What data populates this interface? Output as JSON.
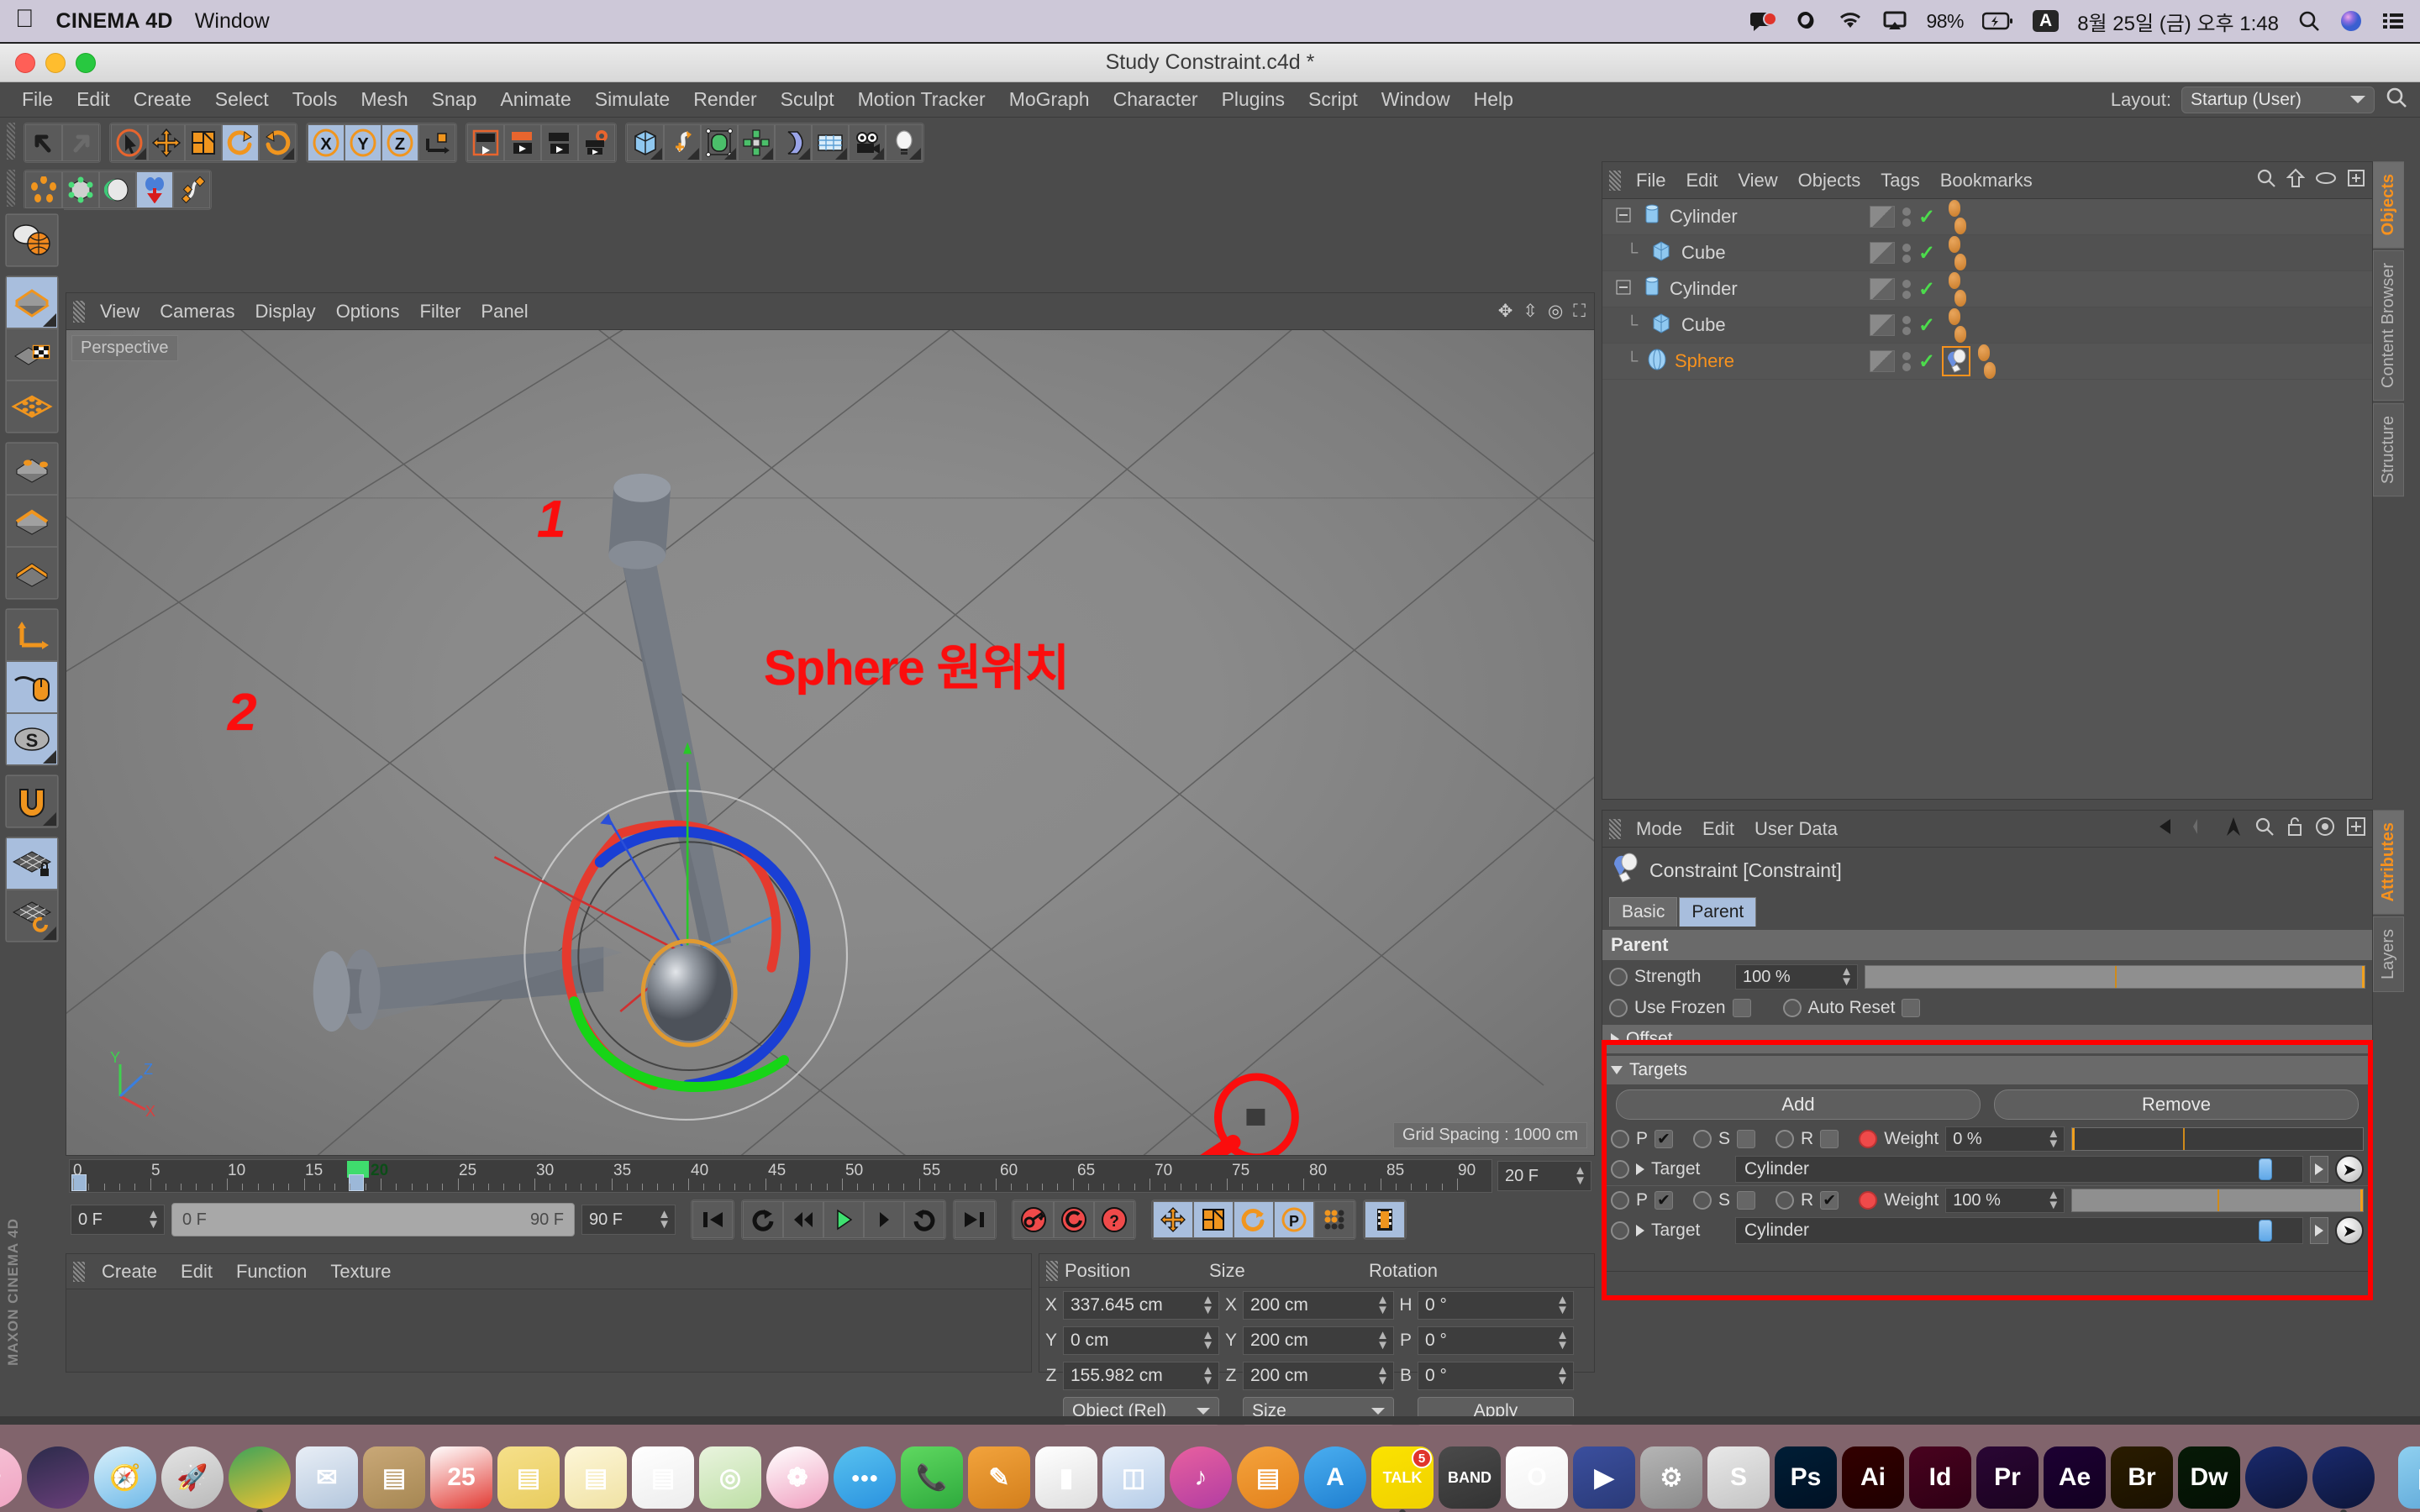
{
  "macbar": {
    "apple": "",
    "app_name": "CINEMA 4D",
    "menus": [
      "Window"
    ],
    "battery": "98%",
    "input_source": "A",
    "clock": "8월 25일 (금) 오후 1:48",
    "icons": [
      "notification-icon",
      "creative-cloud-icon",
      "wifi-icon",
      "airplay-icon",
      "battery-icon",
      "keyboard-icon",
      "spotlight-icon",
      "siri-icon",
      "notification-center-icon"
    ]
  },
  "window": {
    "title": "Study Constraint.c4d *"
  },
  "main_menu": {
    "items": [
      "File",
      "Edit",
      "Create",
      "Select",
      "Tools",
      "Mesh",
      "Snap",
      "Animate",
      "Simulate",
      "Render",
      "Sculpt",
      "Motion Tracker",
      "MoGraph",
      "Character",
      "Plugins",
      "Script",
      "Window",
      "Help"
    ],
    "layout_label": "Layout:",
    "layout_value": "Startup (User)"
  },
  "toolbar": {
    "row1": [
      {
        "name": "undo-icon",
        "glyph": "↰",
        "active": false
      },
      {
        "name": "redo-icon",
        "glyph": "↱",
        "active": false
      },
      {
        "name": "selection-tool-icon",
        "glyph": "➤",
        "active": false
      },
      {
        "name": "move-tool-icon",
        "glyph": "✥",
        "active": false
      },
      {
        "name": "scale-tool-icon",
        "glyph": "◧",
        "active": false
      },
      {
        "name": "rotate-tool-icon",
        "glyph": "⟳",
        "active": true
      },
      {
        "name": "rotate-alt-icon",
        "glyph": "⟲",
        "active": false
      },
      {
        "name": "axis-x-icon",
        "glyph": "X",
        "active": true
      },
      {
        "name": "axis-y-icon",
        "glyph": "Y",
        "active": true
      },
      {
        "name": "axis-z-icon",
        "glyph": "Z",
        "active": true
      },
      {
        "name": "world-coord-icon",
        "glyph": "⌐",
        "active": false
      },
      {
        "name": "render-view-icon",
        "glyph": "▶",
        "active": false
      },
      {
        "name": "render-region-icon",
        "glyph": "▶",
        "active": false
      },
      {
        "name": "render-picture-icon",
        "glyph": "▶",
        "active": false
      },
      {
        "name": "render-settings-icon",
        "glyph": "⚙",
        "active": false
      },
      {
        "name": "cube-primitive-icon",
        "glyph": "◰",
        "active": false
      },
      {
        "name": "spline-icon",
        "glyph": "S",
        "active": false
      },
      {
        "name": "nurbs-icon",
        "glyph": "◲",
        "active": false
      },
      {
        "name": "array-icon",
        "glyph": "✲",
        "active": false
      },
      {
        "name": "bend-deformer-icon",
        "glyph": "◗",
        "active": false
      },
      {
        "name": "floor-icon",
        "glyph": "▦",
        "active": false
      },
      {
        "name": "camera-icon",
        "glyph": "◉",
        "active": false
      },
      {
        "name": "light-icon",
        "glyph": "💡",
        "active": false
      }
    ],
    "row2": [
      {
        "name": "point-mode-icon",
        "glyph": "⬡",
        "active": false
      },
      {
        "name": "edge-mode-icon",
        "glyph": "⬢",
        "active": false
      },
      {
        "name": "polygon-mode-icon",
        "glyph": "◐",
        "active": false
      },
      {
        "name": "model-drop-icon",
        "glyph": "↓",
        "active": true
      },
      {
        "name": "spline-edit-icon",
        "glyph": "∿",
        "active": false
      }
    ]
  },
  "left_rail": [
    {
      "name": "axis-world-toggle-icon",
      "glyph": "◍",
      "active": false
    },
    {
      "name": "model-mode-icon",
      "glyph": "▱",
      "active": true
    },
    {
      "name": "texture-mode-icon",
      "glyph": "▦",
      "active": false
    },
    {
      "name": "polygon-grid-icon",
      "glyph": "◈",
      "active": false
    },
    {
      "name": "points-mode-icon",
      "glyph": "⬭",
      "active": false
    },
    {
      "name": "edges-mode-icon",
      "glyph": "▭",
      "active": false
    },
    {
      "name": "faces-mode-icon",
      "glyph": "▬",
      "active": false
    },
    {
      "name": "axis-move-icon",
      "glyph": "⌐",
      "active": false
    },
    {
      "name": "mouse-enable-icon",
      "glyph": "🖱",
      "active": true
    },
    {
      "name": "soft-selection-icon",
      "glyph": "S",
      "active": true
    },
    {
      "name": "magnet-icon",
      "glyph": "U",
      "active": false
    },
    {
      "name": "workplane-lock-icon",
      "glyph": "▦",
      "active": true
    },
    {
      "name": "workplane-rotate-icon",
      "glyph": "▦",
      "active": false
    }
  ],
  "brand_vertical": "MAXON CINEMA 4D",
  "viewport": {
    "menus": [
      "View",
      "Cameras",
      "Display",
      "Options",
      "Filter",
      "Panel"
    ],
    "perspective_label": "Perspective",
    "grid_spacing": "Grid Spacing : 1000 cm",
    "axis_labels": [
      "Y",
      "Z",
      "X"
    ],
    "annotations": {
      "cylinder1": "1",
      "cylinder2": "2",
      "sphere_origin": "Sphere 원위치"
    },
    "icons": [
      "move-view-icon",
      "scale-view-icon",
      "rotate-view-icon",
      "maximize-view-icon"
    ]
  },
  "timeline": {
    "ticks": [
      "0",
      "5",
      "10",
      "15",
      "20",
      "25",
      "30",
      "35",
      "40",
      "45",
      "50",
      "55",
      "60",
      "65",
      "70",
      "75",
      "80",
      "85",
      "90"
    ],
    "current_frame_label": "20",
    "end_field": "20 F",
    "start_field": "0 F",
    "range_start": "0 F",
    "range_end": "90 F",
    "max_field": "90 F",
    "playback_buttons": [
      {
        "name": "go-to-start-icon",
        "glyph": "⏮"
      },
      {
        "name": "previous-key-icon",
        "glyph": "↺"
      },
      {
        "name": "step-back-icon",
        "glyph": "◀◀"
      },
      {
        "name": "play-icon",
        "glyph": "▶"
      },
      {
        "name": "step-forward-icon",
        "glyph": "▶"
      },
      {
        "name": "next-key-icon",
        "glyph": "↻"
      },
      {
        "name": "go-to-end-icon",
        "glyph": "⏭"
      }
    ],
    "record_buttons": [
      {
        "name": "record-key-icon",
        "glyph": "🔑"
      },
      {
        "name": "autokey-icon",
        "glyph": "◉"
      },
      {
        "name": "keyframe-help-icon",
        "glyph": "?"
      }
    ],
    "key_toggles": [
      {
        "name": "key-position-icon",
        "glyph": "✥",
        "active": true
      },
      {
        "name": "key-scale-icon",
        "glyph": "◧",
        "active": true
      },
      {
        "name": "key-rotation-icon",
        "glyph": "⟳",
        "active": true
      },
      {
        "name": "key-param-icon",
        "glyph": "P",
        "active": true
      },
      {
        "name": "key-pla-icon",
        "glyph": "⣿",
        "active": false
      },
      {
        "name": "timeline-icon",
        "glyph": "▤",
        "active": true
      }
    ]
  },
  "material_manager": {
    "menus": [
      "Create",
      "Edit",
      "Function",
      "Texture"
    ]
  },
  "coordinates": {
    "headers": [
      "Position",
      "Size",
      "Rotation"
    ],
    "rows": [
      {
        "pos_label": "X",
        "pos_value": "337.645 cm",
        "size_label": "X",
        "size_value": "200 cm",
        "rot_label": "H",
        "rot_value": "0 °"
      },
      {
        "pos_label": "Y",
        "pos_value": "0 cm",
        "size_label": "Y",
        "size_value": "200 cm",
        "rot_label": "P",
        "rot_value": "0 °"
      },
      {
        "pos_label": "Z",
        "pos_value": "155.982 cm",
        "size_label": "Z",
        "size_value": "200 cm",
        "rot_label": "B",
        "rot_value": "0 °"
      }
    ],
    "mode_dropdown": "Object (Rel)",
    "size_dropdown": "Size",
    "apply_button": "Apply"
  },
  "object_manager": {
    "menus": [
      "File",
      "Edit",
      "View",
      "Objects",
      "Tags",
      "Bookmarks"
    ],
    "icons": [
      "search-icon",
      "home-icon",
      "eye-icon",
      "expand-icon"
    ],
    "objects": [
      {
        "name": "Cylinder",
        "type": "cylinder",
        "indent": 0,
        "expandable": true,
        "selected": false,
        "tags": 2,
        "has_constraint": false
      },
      {
        "name": "Cube",
        "type": "cube",
        "indent": 1,
        "expandable": false,
        "selected": false,
        "tags": 2,
        "has_constraint": false
      },
      {
        "name": "Cylinder",
        "type": "cylinder",
        "indent": 0,
        "expandable": true,
        "selected": false,
        "tags": 2,
        "has_constraint": false
      },
      {
        "name": "Cube",
        "type": "cube",
        "indent": 1,
        "expandable": false,
        "selected": false,
        "tags": 2,
        "has_constraint": false
      },
      {
        "name": "Sphere",
        "type": "sphere",
        "indent": 1,
        "expandable": false,
        "selected": true,
        "tags": 2,
        "has_constraint": true
      }
    ]
  },
  "attributes": {
    "menus": [
      "Mode",
      "Edit",
      "User Data"
    ],
    "icons": [
      "back-icon",
      "forward-icon",
      "up-icon",
      "search-icon",
      "lock-icon",
      "target-icon",
      "add-icon"
    ],
    "object_title": "Constraint [Constraint]",
    "tabs": [
      {
        "label": "Basic",
        "active": false
      },
      {
        "label": "Parent",
        "active": true
      }
    ],
    "section_title": "Parent",
    "strength_label": "Strength",
    "strength_value": "100 %",
    "use_frozen_label": "Use Frozen",
    "auto_reset_label": "Auto Reset",
    "offset_label": "Offset",
    "targets_label": "Targets",
    "add_button": "Add",
    "remove_button": "Remove",
    "target_rows": [
      {
        "p_label": "P",
        "p_checked": true,
        "s_label": "S",
        "s_checked": false,
        "r_label": "R",
        "r_checked": false,
        "weight_label": "Weight",
        "weight_value": "0 %",
        "weight_pct": 0,
        "target_label": "Target",
        "target_value": "Cylinder"
      },
      {
        "p_label": "P",
        "p_checked": true,
        "s_label": "S",
        "s_checked": false,
        "r_label": "R",
        "r_checked": true,
        "weight_label": "Weight",
        "weight_value": "100 %",
        "weight_pct": 100,
        "target_label": "Target",
        "target_value": "Cylinder"
      }
    ]
  },
  "vertical_tabs_top": [
    {
      "label": "Objects",
      "active": true
    },
    {
      "label": "Content Browser",
      "active": false
    },
    {
      "label": "Structure",
      "active": false
    }
  ],
  "vertical_tabs_bottom": [
    {
      "label": "Attributes",
      "active": true
    },
    {
      "label": "Layers",
      "active": false
    }
  ],
  "dock": [
    {
      "name": "finder-icon",
      "label": "☺",
      "color1": "#4aa3e8",
      "color2": "#2b7fc9",
      "round": false,
      "running": true
    },
    {
      "name": "sakura-icon",
      "label": "❀",
      "color1": "#f7c5d8",
      "color2": "#efa4c2",
      "round": true,
      "running": false
    },
    {
      "name": "siri-icon",
      "label": "",
      "color1": "#2b2b4a",
      "color2": "#6a3f7a",
      "round": true,
      "running": false
    },
    {
      "name": "safari-icon",
      "label": "🧭",
      "color1": "#d8f0fb",
      "color2": "#6fb9e8",
      "round": true,
      "running": false
    },
    {
      "name": "launchpad-icon",
      "label": "🚀",
      "color1": "#e4e4e4",
      "color2": "#b9b9b9",
      "round": true,
      "running": false
    },
    {
      "name": "chrome-icon",
      "label": "",
      "color1": "#3ea35a",
      "color2": "#f2c230",
      "round": true,
      "running": true
    },
    {
      "name": "mail-icon",
      "label": "✉",
      "color1": "#e8eef6",
      "color2": "#b4c7dd",
      "round": false,
      "running": false
    },
    {
      "name": "contacts-icon",
      "label": "▤",
      "color1": "#c9a877",
      "color2": "#a68753",
      "round": false,
      "running": false
    },
    {
      "name": "calendar-icon",
      "label": "25",
      "color1": "#ffffff",
      "color2": "#e23b34",
      "round": false,
      "running": false
    },
    {
      "name": "notes-yellow-icon",
      "label": "▤",
      "color1": "#f6e08a",
      "color2": "#e8cc5f",
      "round": false,
      "running": false
    },
    {
      "name": "notes-icon",
      "label": "▤",
      "color1": "#fdf6d8",
      "color2": "#f0e2a4",
      "round": false,
      "running": false
    },
    {
      "name": "reminders-icon",
      "label": "▤",
      "color1": "#ffffff",
      "color2": "#ededed",
      "round": false,
      "running": false
    },
    {
      "name": "maps-icon",
      "label": "◎",
      "color1": "#e9f4de",
      "color2": "#bedfa6",
      "round": false,
      "running": false
    },
    {
      "name": "photos-icon",
      "label": "❁",
      "color1": "#ffffff",
      "color2": "#f0a0c0",
      "round": true,
      "running": false
    },
    {
      "name": "messages-icon",
      "label": "●●●",
      "color1": "#58c2f0",
      "color2": "#2a92df",
      "round": true,
      "running": false
    },
    {
      "name": "facetime-icon",
      "label": "📞",
      "color1": "#5fd860",
      "color2": "#2eaa3d",
      "round": false,
      "running": false
    },
    {
      "name": "pages-icon",
      "label": "✎",
      "color1": "#f2a33c",
      "color2": "#d37f1c",
      "round": false,
      "running": false
    },
    {
      "name": "numbers-icon",
      "label": "▮",
      "color1": "#ffffff",
      "color2": "#dedede",
      "round": false,
      "running": false
    },
    {
      "name": "keynote-icon",
      "label": "◫",
      "color1": "#e8f0fa",
      "color2": "#b6cde8",
      "round": false,
      "running": false
    },
    {
      "name": "itunes-icon",
      "label": "♪",
      "color1": "#e8609f",
      "color2": "#b23da2",
      "round": true,
      "running": false
    },
    {
      "name": "ibooks-icon",
      "label": "▤",
      "color1": "#f5a33c",
      "color2": "#e2811c",
      "round": true,
      "running": false
    },
    {
      "name": "appstore-icon",
      "label": "A",
      "color1": "#4aaef0",
      "color2": "#1f7fd0",
      "round": true,
      "running": false
    },
    {
      "name": "kakaotalk-icon",
      "label": "TALK",
      "color1": "#fbe300",
      "color2": "#f0d000",
      "round": false,
      "running": true,
      "badge": "5"
    },
    {
      "name": "band-icon",
      "label": "BAND",
      "color1": "#4a4a4a",
      "color2": "#333333",
      "round": false,
      "running": false
    },
    {
      "name": "naver-icon",
      "label": "O",
      "color1": "#ffffff",
      "color2": "#f0f0f0",
      "round": false,
      "running": false
    },
    {
      "name": "player-icon",
      "label": "▶",
      "color1": "#3b4f9e",
      "color2": "#2a3a78",
      "round": false,
      "running": false
    },
    {
      "name": "system-prefs-icon",
      "label": "⚙",
      "color1": "#b5b5b5",
      "color2": "#8a8a8a",
      "round": false,
      "running": false
    },
    {
      "name": "sketch-icon",
      "label": "S",
      "color1": "#e8e8e8",
      "color2": "#c4c4c4",
      "round": false,
      "running": false
    },
    {
      "name": "photoshop-icon",
      "label": "Ps",
      "color1": "#001e36",
      "color2": "#001124",
      "round": false,
      "running": false
    },
    {
      "name": "illustrator-icon",
      "label": "Ai",
      "color1": "#330000",
      "color2": "#1f0000",
      "round": false,
      "running": false
    },
    {
      "name": "indesign-icon",
      "label": "Id",
      "color1": "#49021f",
      "color2": "#2e0014",
      "round": false,
      "running": false
    },
    {
      "name": "premiere-icon",
      "label": "Pr",
      "color1": "#2a0634",
      "color2": "#1b0320",
      "round": false,
      "running": false
    },
    {
      "name": "aftereffects-icon",
      "label": "Ae",
      "color1": "#1d0033",
      "color2": "#120020",
      "round": false,
      "running": false
    },
    {
      "name": "bridge-icon",
      "label": "Br",
      "color1": "#2a1c00",
      "color2": "#1a1100",
      "round": false,
      "running": false
    },
    {
      "name": "dreamweaver-icon",
      "label": "Dw",
      "color1": "#071a07",
      "color2": "#041004",
      "round": false,
      "running": false
    },
    {
      "name": "cinema4d-icon",
      "label": "",
      "color1": "#1a2a6e",
      "color2": "#0d1538",
      "round": true,
      "running": false
    },
    {
      "name": "cinema4d-running-icon",
      "label": "",
      "color1": "#1a2a6e",
      "color2": "#0d1538",
      "round": true,
      "running": true
    },
    {
      "name": "downloads-folder-icon",
      "label": "▤",
      "color1": "#8fd0f0",
      "color2": "#5fa8d8",
      "round": false,
      "running": false
    },
    {
      "name": "trash-icon",
      "label": "▯",
      "color1": "#e8e8e8",
      "color2": "#c8c8c8",
      "round": false,
      "running": false
    }
  ]
}
